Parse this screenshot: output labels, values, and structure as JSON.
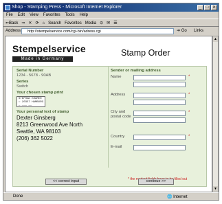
{
  "browser": {
    "title": "Shop - Stamping Press - Microsoft Internet Explorer",
    "menu": [
      "File",
      "Edit",
      "View",
      "Favorites",
      "Tools",
      "Help"
    ],
    "toolbar": [
      "⇐Back",
      "⇒",
      "✕",
      "⟳",
      "⌂",
      "Search",
      "Favorites",
      "Media",
      "⊙",
      "✉",
      "☰"
    ],
    "address_label": "Address",
    "address_url": "http://stempelservice.com/cgi-bin/adress.cgi",
    "go_label": "Go",
    "links_label": "Links",
    "status_left": "Done",
    "status_zone": "Internet"
  },
  "page": {
    "brand_name": "Stempelservice",
    "brand_sub": "Made in Germany",
    "title": "Stamp Order",
    "left": {
      "serial_label": "Serial Number",
      "serial_value": "1234 - 5678 - 90AB",
      "series_label": "Series",
      "series_value": "Switch",
      "print_label": "Your chosen stamp print",
      "print_lines": [
        "STEPHAN KRÄMER",
        "○ 20357 HAMBURG",
        "— ——— ——"
      ],
      "text_label": "Your personal text of stamp",
      "text_lines": [
        "Dexter Ginsberg",
        "8213 Greenwood Ave North",
        "Seattle, WA 98103",
        "(206) 362 5022"
      ]
    },
    "right": {
      "section_title": "Sender or mailing address",
      "name_label": "Name",
      "address_label": "Address",
      "city_label": "City and postal code",
      "country_label": "Country",
      "email_label": "E-mail",
      "req_mark": "*",
      "note": "* the marked fields have to be filled out"
    },
    "buttons": {
      "back": "<< correct input",
      "continue": "continue >>"
    }
  }
}
